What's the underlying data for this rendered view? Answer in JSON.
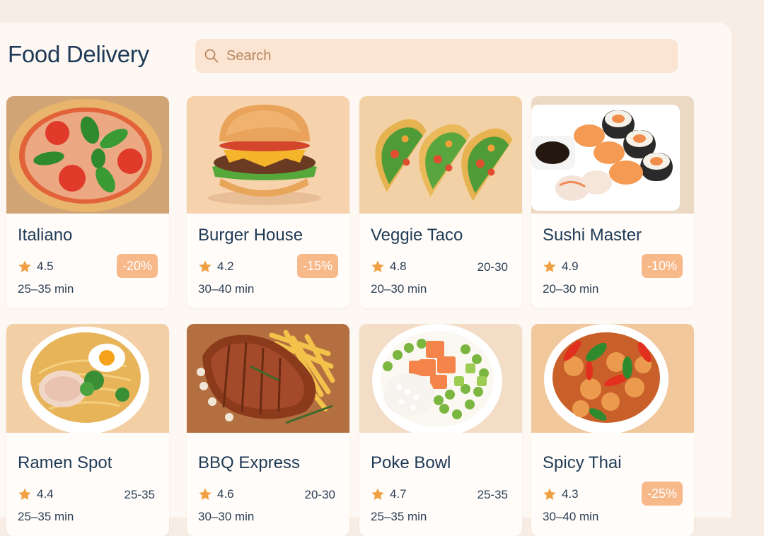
{
  "header": {
    "title": "Food Delivery"
  },
  "search": {
    "placeholder": "Search"
  },
  "restaurants": [
    {
      "name": "Italiano",
      "rating": "4.5",
      "time": "25–35 min",
      "badge": "-20%",
      "image_icon": "pizza-icon"
    },
    {
      "name": "Burger House",
      "rating": "4.2",
      "time": "30–40 min",
      "badge": "-15%",
      "image_icon": "burger-icon"
    },
    {
      "name": "Veggie Taco",
      "rating": "4.8",
      "time": "20–30 min",
      "eta": "20-30",
      "image_icon": "taco-icon"
    },
    {
      "name": "Sushi Master",
      "rating": "4.9",
      "time": "20–30 min",
      "badge": "-10%",
      "image_icon": "sushi-icon"
    },
    {
      "name": "Ramen Spot",
      "rating": "4.4",
      "time": "25–35 min",
      "eta": "25-35",
      "image_icon": "ramen-icon"
    },
    {
      "name": "BBQ Express",
      "rating": "4.6",
      "time": "30–30 min",
      "eta": "20-30",
      "image_icon": "ribs-icon"
    },
    {
      "name": "Poke Bowl",
      "rating": "4.7",
      "time": "25–35 min",
      "eta": "25-35",
      "image_icon": "poke-bowl-icon"
    },
    {
      "name": "Spicy Thai",
      "rating": "4.3",
      "time": "30–40 min",
      "badge": "-25%",
      "image_icon": "curry-bowl-icon"
    }
  ],
  "colors": {
    "accent_badge": "#f7b98a",
    "star": "#f0a043",
    "title_text": "#1f3a56",
    "search_bg": "#fbe5d2"
  }
}
